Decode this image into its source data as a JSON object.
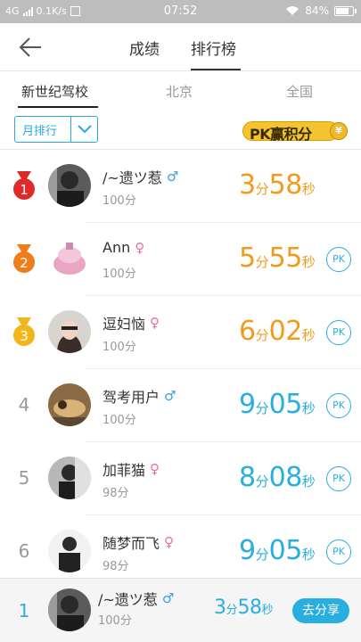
{
  "status_bar": {
    "network": "4G",
    "speed": "0.1K/s",
    "time": "07:52",
    "battery": "84%",
    "battery_level": 0.84
  },
  "header": {
    "tabs": [
      {
        "label": "成绩",
        "active": false
      },
      {
        "label": "排行榜",
        "active": true
      }
    ]
  },
  "subtabs": [
    {
      "label": "新世纪驾校",
      "active": true
    },
    {
      "label": "北京",
      "active": false
    },
    {
      "label": "全国",
      "active": false
    }
  ],
  "filter": {
    "label": "月排行"
  },
  "pk_badge": {
    "text": "PK赢积分",
    "coin": "¥"
  },
  "rankings": [
    {
      "rank": "1",
      "name": "/~遗ツ惹",
      "gender": "male",
      "score": "100分",
      "minutes": "3",
      "seconds": "58",
      "min_unit": "分",
      "sec_unit": "秒",
      "color": "orange",
      "pk": ""
    },
    {
      "rank": "2",
      "name": "Ann",
      "gender": "female",
      "score": "100分",
      "minutes": "5",
      "seconds": "55",
      "min_unit": "分",
      "sec_unit": "秒",
      "color": "orange",
      "pk": "PK"
    },
    {
      "rank": "3",
      "name": "逗妇恼",
      "gender": "female",
      "score": "100分",
      "minutes": "6",
      "seconds": "02",
      "min_unit": "分",
      "sec_unit": "秒",
      "color": "orange",
      "pk": "PK"
    },
    {
      "rank": "4",
      "name": "驾考用户",
      "gender": "male",
      "score": "100分",
      "minutes": "9",
      "seconds": "05",
      "min_unit": "分",
      "sec_unit": "秒",
      "color": "blue",
      "pk": "PK"
    },
    {
      "rank": "5",
      "name": "加菲猫",
      "gender": "female",
      "score": "98分",
      "minutes": "8",
      "seconds": "08",
      "min_unit": "分",
      "sec_unit": "秒",
      "color": "blue",
      "pk": "PK"
    },
    {
      "rank": "6",
      "name": "随梦而飞",
      "gender": "female",
      "score": "98分",
      "minutes": "9",
      "seconds": "05",
      "min_unit": "分",
      "sec_unit": "秒",
      "color": "blue",
      "pk": "PK"
    }
  ],
  "my_rank": {
    "rank": "1",
    "name": "/~遗ツ惹",
    "gender": "male",
    "score": "100分",
    "minutes": "3",
    "seconds": "58",
    "min_unit": "分",
    "sec_unit": "秒",
    "share_label": "去分享"
  },
  "symbols": {
    "male": "♂",
    "female": "♀"
  },
  "colors": {
    "accent_blue": "#29aee0",
    "orange": "#f29b1b",
    "medal_gold": "#f2b51c",
    "medal_silver": "#ef7d1a",
    "medal_red": "#e02a2a"
  }
}
